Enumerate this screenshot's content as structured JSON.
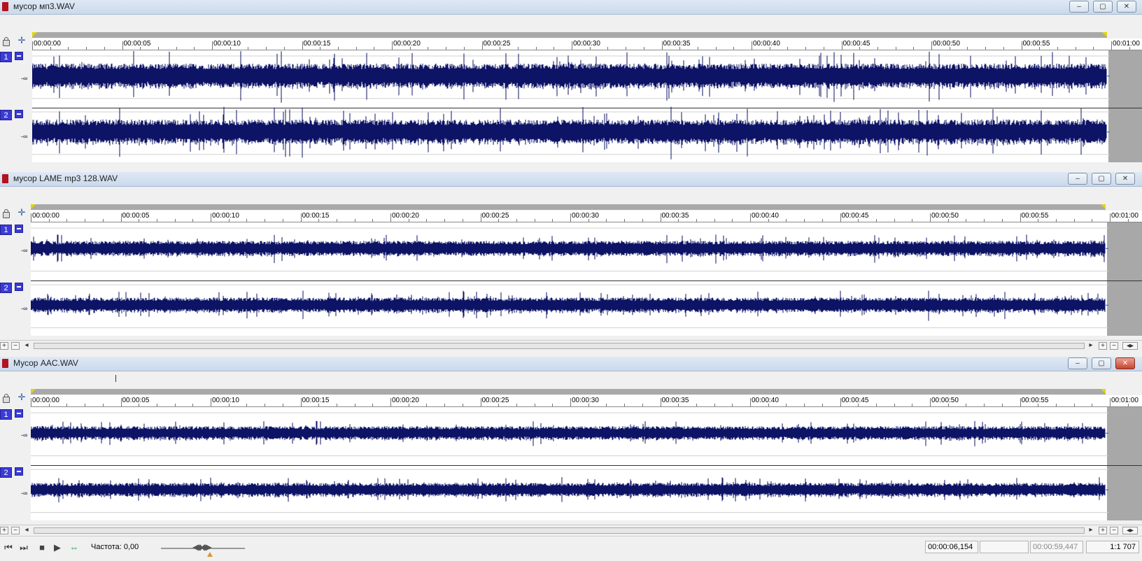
{
  "windows": [
    {
      "title": "мусор мп3.WAV",
      "close_active": false
    },
    {
      "title": "мусор LAME mp3 128.WAV",
      "close_active": false
    },
    {
      "title": "Мусор AAC.WAV",
      "close_active": true
    }
  ],
  "window_buttons": {
    "minimize": "‒",
    "maximize": "▢",
    "close": "✕"
  },
  "ruler_labels": [
    "00:00:00",
    "00:00:05",
    "00:00:10",
    "00:00:15",
    "00:00:20",
    "00:00:25",
    "00:00:30",
    "00:00:35",
    "00:00:40",
    "00:00:45",
    "00:00:50",
    "00:00:55",
    "00:01:00"
  ],
  "channels": [
    "1",
    "2"
  ],
  "channel_level_label": "-∞",
  "scroll_buttons": {
    "zoom_in": "+",
    "zoom_out": "−",
    "left": "◂",
    "right": "▸",
    "fit": "◂▸"
  },
  "transport": {
    "prev": "⏮",
    "next": "⏭",
    "stop": "■",
    "play": "▶",
    "loop": "⇔"
  },
  "status": {
    "frequency": "Частота: 0,00",
    "cursor_time": "00:00:06,154",
    "selection_length": "",
    "total_length": "00:00:59,447",
    "zoom_ratio": "1:1 707"
  },
  "colors": {
    "waveform": "#0d1466",
    "channel_button": "#3b3bd6",
    "marker": "#e3d500"
  }
}
